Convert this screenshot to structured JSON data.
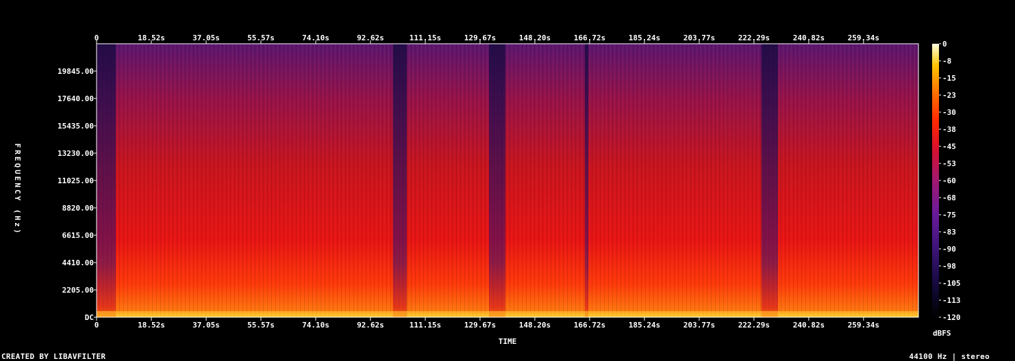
{
  "chart_data": {
    "type": "heatmap",
    "title": "",
    "xlabel": "TIME",
    "ylabel": "FREQUENCY (Hz)",
    "x_ticks": [
      "0",
      "18.52s",
      "37.05s",
      "55.57s",
      "74.10s",
      "92.62s",
      "111.15s",
      "129.67s",
      "148.20s",
      "166.72s",
      "185.24s",
      "203.77s",
      "222.29s",
      "240.82s",
      "259.34s"
    ],
    "x_tick_values_s": [
      0,
      18.52,
      37.05,
      55.57,
      74.1,
      92.62,
      111.15,
      129.67,
      148.2,
      166.72,
      185.24,
      203.77,
      222.29,
      240.82,
      259.34
    ],
    "x_range_s": [
      0,
      277.9
    ],
    "y_ticks": [
      "DC",
      "2205.00",
      "4410.00",
      "6615.00",
      "8820.00",
      "11025.00",
      "13230.00",
      "15435.00",
      "17640.00",
      "19845.00"
    ],
    "y_tick_values_hz": [
      0,
      2205,
      4410,
      6615,
      8820,
      11025,
      13230,
      15435,
      17640,
      19845
    ],
    "y_range_hz": [
      0,
      22050
    ],
    "colorbar": {
      "label": "dBFS",
      "ticks": [
        "0",
        "-8",
        "-15",
        "-23",
        "-30",
        "-38",
        "-45",
        "-53",
        "-60",
        "-68",
        "-75",
        "-83",
        "-90",
        "-98",
        "-105",
        "-113",
        "-120"
      ],
      "range_db": [
        -120,
        0
      ]
    },
    "colormap": [
      "#000000",
      "#1a0b4a",
      "#4a1a8c",
      "#7d1ea8",
      "#b0186e",
      "#e0101a",
      "#ff3300",
      "#ff8000",
      "#ffd000",
      "#ffffc8"
    ],
    "quiet_intervals_s": [
      [
        0,
        6.5
      ],
      [
        100.2,
        104.9
      ],
      [
        132.7,
        138.2
      ],
      [
        165.1,
        166.3
      ],
      [
        224.8,
        230.4
      ]
    ]
  },
  "footer": {
    "credit": "CREATED BY LIBAVFILTER",
    "format": "44100 Hz | stereo"
  }
}
